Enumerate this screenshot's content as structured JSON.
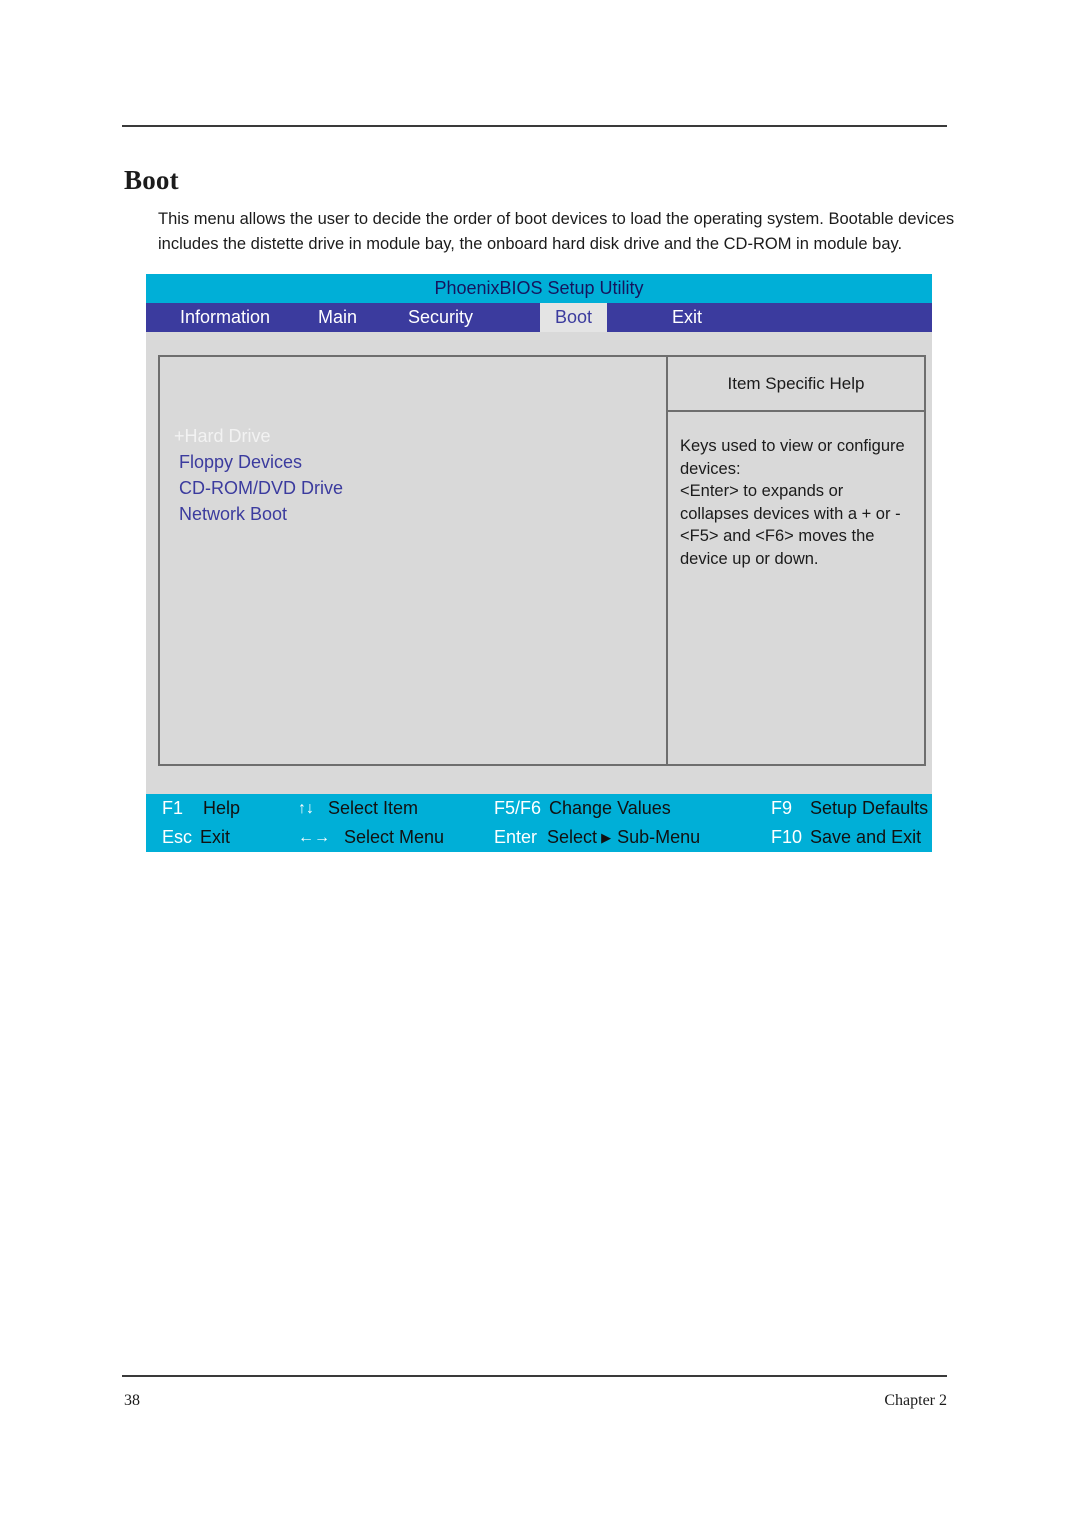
{
  "document": {
    "heading": "Boot",
    "body_text": "This menu allows the user to decide the order of boot devices to load the operating system. Bootable devices includes the distette drive in module bay, the onboard hard disk drive and the CD-ROM in module bay.",
    "footer_page_number": "38",
    "footer_chapter": "Chapter 2"
  },
  "bios": {
    "title": "PhoenixBIOS Setup Utility",
    "tabs": [
      {
        "label": "Information",
        "active": false
      },
      {
        "label": "Main",
        "active": false
      },
      {
        "label": "Security",
        "active": false
      },
      {
        "label": "Boot",
        "active": true
      },
      {
        "label": "Exit",
        "active": false
      }
    ],
    "boot_items": [
      {
        "label": "+Hard Drive",
        "dimmed": true
      },
      {
        "label": " Floppy Devices",
        "dimmed": false
      },
      {
        "label": " CD-ROM/DVD Drive",
        "dimmed": false
      },
      {
        "label": " Network Boot",
        "dimmed": false
      }
    ],
    "help": {
      "title": "Item Specific Help",
      "text": "Keys used to view or configure devices:\n<Enter> to expands or collapses devices with a + or -\n<F5>  and <F6> moves the device up or down."
    },
    "key_bar": {
      "row1": [
        {
          "key": "F1",
          "desc": "Help",
          "arrows": ""
        },
        {
          "key": "",
          "desc": "Select Item",
          "arrows": "↑↓"
        },
        {
          "key": "F5/F6",
          "desc": "Change Values",
          "arrows": ""
        },
        {
          "key": "F9",
          "desc": "Setup Defaults",
          "arrows": ""
        }
      ],
      "row2": [
        {
          "key": "Esc",
          "desc": "Exit",
          "arrows": ""
        },
        {
          "key": "",
          "desc": "Select Menu",
          "arrows": "←→"
        },
        {
          "key": "Enter",
          "desc": "Select",
          "desc2": "Sub-Menu",
          "arrows": ""
        },
        {
          "key": "F10",
          "desc": "Save and Exit",
          "arrows": ""
        }
      ]
    },
    "colors": {
      "title_bar": "#00afd7",
      "tab_bar": "#3b3b9e",
      "panel_bg": "#d9d9d9",
      "accent_text": "#3b3b9e"
    }
  }
}
